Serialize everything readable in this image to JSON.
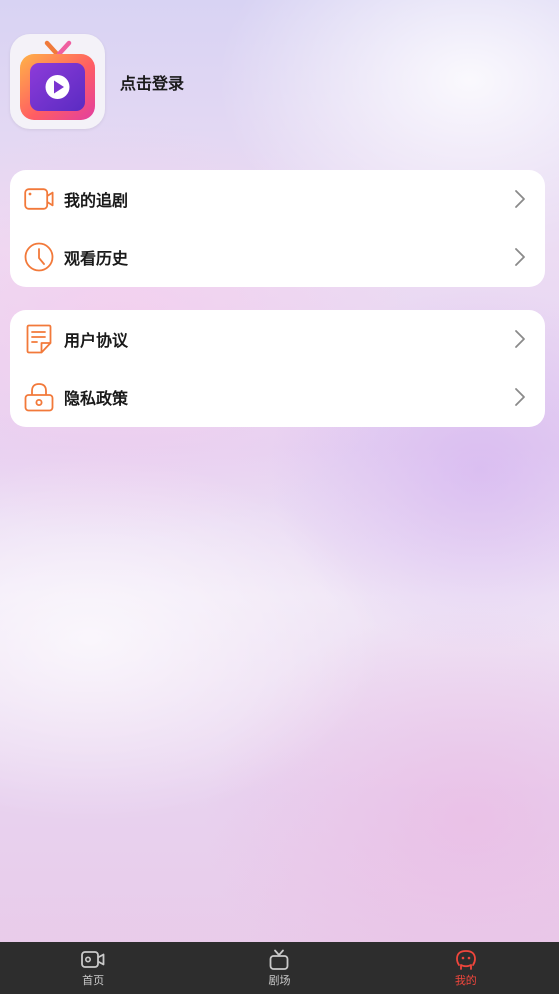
{
  "profile": {
    "login_label": "点击登录",
    "avatar_icon": "tv-play-logo-icon"
  },
  "menu_groups": [
    {
      "items": [
        {
          "label": "我的追剧",
          "icon": "video-camera-icon"
        },
        {
          "label": "观看历史",
          "icon": "clock-icon"
        }
      ]
    },
    {
      "items": [
        {
          "label": "用户协议",
          "icon": "document-icon"
        },
        {
          "label": "隐私政策",
          "icon": "lock-icon"
        }
      ]
    }
  ],
  "tabbar": {
    "tabs": [
      {
        "label": "首页",
        "icon": "video-icon",
        "active": false
      },
      {
        "label": "剧场",
        "icon": "tv-icon",
        "active": false
      },
      {
        "label": "我的",
        "icon": "smiley-icon",
        "active": true
      }
    ]
  },
  "colors": {
    "accent_orange": "#f2793a",
    "tab_active": "#f0463c",
    "tab_inactive": "#c9c9c9",
    "tabbar_bg": "#2d2d2d"
  }
}
